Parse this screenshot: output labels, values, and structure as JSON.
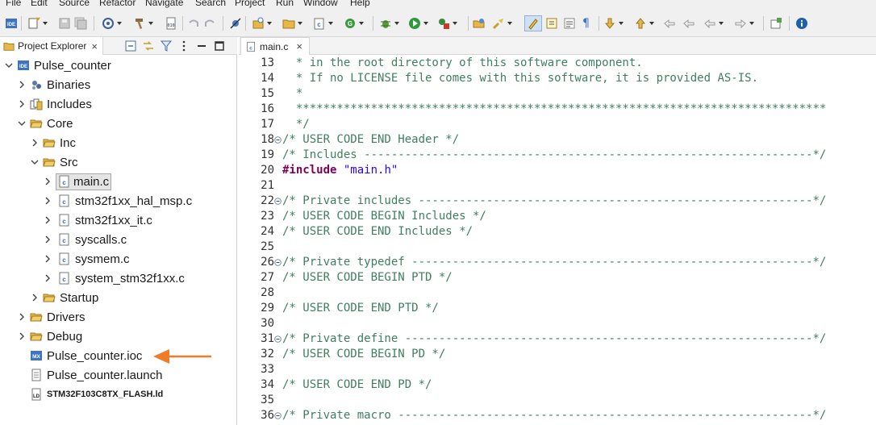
{
  "menu": [
    "File",
    "Edit",
    "Source",
    "Refactor",
    "Navigate",
    "Search",
    "Project",
    "Run",
    "Window",
    "Help"
  ],
  "explorer": {
    "tab_label": "Project Explorer",
    "tab_close": "×",
    "project": "Pulse_counter",
    "items": {
      "binaries": "Binaries",
      "includes": "Includes",
      "core": "Core",
      "inc": "Inc",
      "src": "Src",
      "main_c": "main.c",
      "hal_msp": "stm32f1xx_hal_msp.c",
      "it": "stm32f1xx_it.c",
      "syscalls": "syscalls.c",
      "sysmem": "sysmem.c",
      "system": "system_stm32f1xx.c",
      "startup": "Startup",
      "drivers": "Drivers",
      "debug": "Debug",
      "ioc": "Pulse_counter.ioc",
      "launch": "Pulse_counter.launch",
      "ld": "STM32F103C8TX_FLASH.ld"
    }
  },
  "editor": {
    "tab_label": "main.c",
    "tab_close": "×",
    "lines": [
      {
        "n": "13",
        "fold": false,
        "parts": [
          {
            "c": "cm",
            "t": "  * in the root directory of this software component."
          }
        ]
      },
      {
        "n": "14",
        "fold": false,
        "parts": [
          {
            "c": "cm",
            "t": "  * If no LICENSE file comes with this software, it is provided AS-IS."
          }
        ]
      },
      {
        "n": "15",
        "fold": false,
        "parts": [
          {
            "c": "cm",
            "t": "  *"
          }
        ]
      },
      {
        "n": "16",
        "fold": false,
        "parts": [
          {
            "c": "cm",
            "t": "  ******************************************************************************"
          }
        ]
      },
      {
        "n": "17",
        "fold": false,
        "parts": [
          {
            "c": "cm",
            "t": "  */"
          }
        ]
      },
      {
        "n": "18",
        "fold": true,
        "parts": [
          {
            "c": "cm",
            "t": "/* USER CODE END Header */"
          }
        ]
      },
      {
        "n": "19",
        "fold": false,
        "parts": [
          {
            "c": "cm",
            "t": "/* Includes ------------------------------------------------------------------*/"
          }
        ]
      },
      {
        "n": "20",
        "fold": false,
        "parts": [
          {
            "c": "pp",
            "t": "#include"
          },
          {
            "c": "",
            "t": " "
          },
          {
            "c": "st",
            "t": "\"main.h\""
          }
        ]
      },
      {
        "n": "21",
        "fold": false,
        "parts": []
      },
      {
        "n": "22",
        "fold": true,
        "parts": [
          {
            "c": "cm",
            "t": "/* Private includes ----------------------------------------------------------*/"
          }
        ]
      },
      {
        "n": "23",
        "fold": false,
        "parts": [
          {
            "c": "cm",
            "t": "/* USER CODE BEGIN Includes */"
          }
        ]
      },
      {
        "n": "24",
        "fold": false,
        "parts": [
          {
            "c": "cm",
            "t": "/* USER CODE END Includes */"
          }
        ]
      },
      {
        "n": "25",
        "fold": false,
        "parts": []
      },
      {
        "n": "26",
        "fold": true,
        "parts": [
          {
            "c": "cm",
            "t": "/* Private typedef -----------------------------------------------------------*/"
          }
        ]
      },
      {
        "n": "27",
        "fold": false,
        "parts": [
          {
            "c": "cm",
            "t": "/* USER CODE BEGIN PTD */"
          }
        ]
      },
      {
        "n": "28",
        "fold": false,
        "parts": []
      },
      {
        "n": "29",
        "fold": false,
        "parts": [
          {
            "c": "cm",
            "t": "/* USER CODE END PTD */"
          }
        ]
      },
      {
        "n": "30",
        "fold": false,
        "parts": []
      },
      {
        "n": "31",
        "fold": true,
        "parts": [
          {
            "c": "cm",
            "t": "/* Private define ------------------------------------------------------------*/"
          }
        ]
      },
      {
        "n": "32",
        "fold": false,
        "parts": [
          {
            "c": "cm",
            "t": "/* USER CODE BEGIN PD */"
          }
        ]
      },
      {
        "n": "33",
        "fold": false,
        "parts": []
      },
      {
        "n": "34",
        "fold": false,
        "parts": [
          {
            "c": "cm",
            "t": "/* USER CODE END PD */"
          }
        ]
      },
      {
        "n": "35",
        "fold": false,
        "parts": []
      },
      {
        "n": "36",
        "fold": true,
        "parts": [
          {
            "c": "cm",
            "t": "/* Private macro -------------------------------------------------------------*/"
          }
        ]
      }
    ]
  },
  "colors": {
    "arrow": "#f07c2a",
    "folder": "#e6b84a",
    "accent": "#3e73c4"
  }
}
